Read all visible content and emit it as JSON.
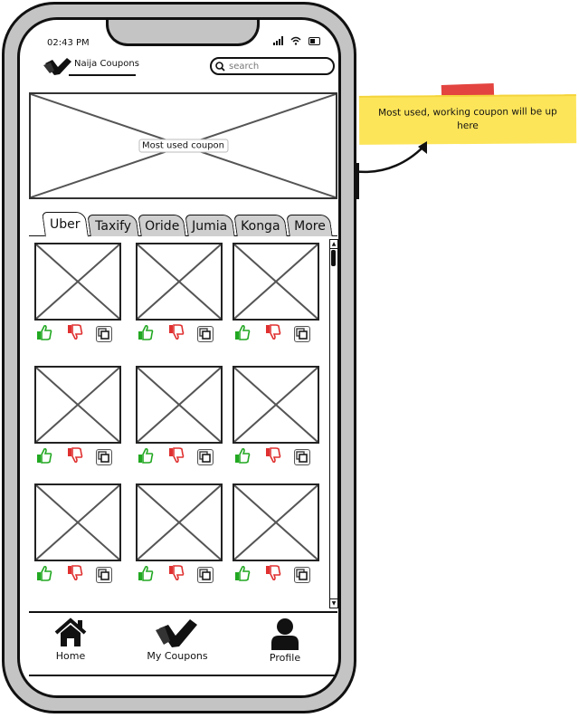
{
  "status_bar": {
    "time": "02:43 PM"
  },
  "header": {
    "app_name": "Naija Coupons",
    "search": {
      "placeholder": "search",
      "value": ""
    }
  },
  "banner": {
    "label": "Most used coupon"
  },
  "tabs": [
    {
      "label": "Uber",
      "active": true
    },
    {
      "label": "Taxify",
      "active": false
    },
    {
      "label": "Oride",
      "active": false
    },
    {
      "label": "Jumia",
      "active": false
    },
    {
      "label": "Konga",
      "active": false
    },
    {
      "label": "More",
      "active": false
    }
  ],
  "coupons": {
    "rows": 3,
    "columns": 3,
    "actions": [
      "thumbs-up",
      "thumbs-down",
      "copy"
    ]
  },
  "bottom_nav": [
    {
      "label": "Home",
      "icon": "home-icon"
    },
    {
      "label": "My Coupons",
      "icon": "coupons-icon"
    },
    {
      "label": "Profile",
      "icon": "profile-icon"
    }
  ],
  "annotation": {
    "text": "Most used, working coupon will be up here"
  },
  "colors": {
    "like": "#22a822",
    "dislike": "#e03030",
    "note": "#fde55a",
    "tape": "#e0302a",
    "frame": "#c4c4c4"
  }
}
